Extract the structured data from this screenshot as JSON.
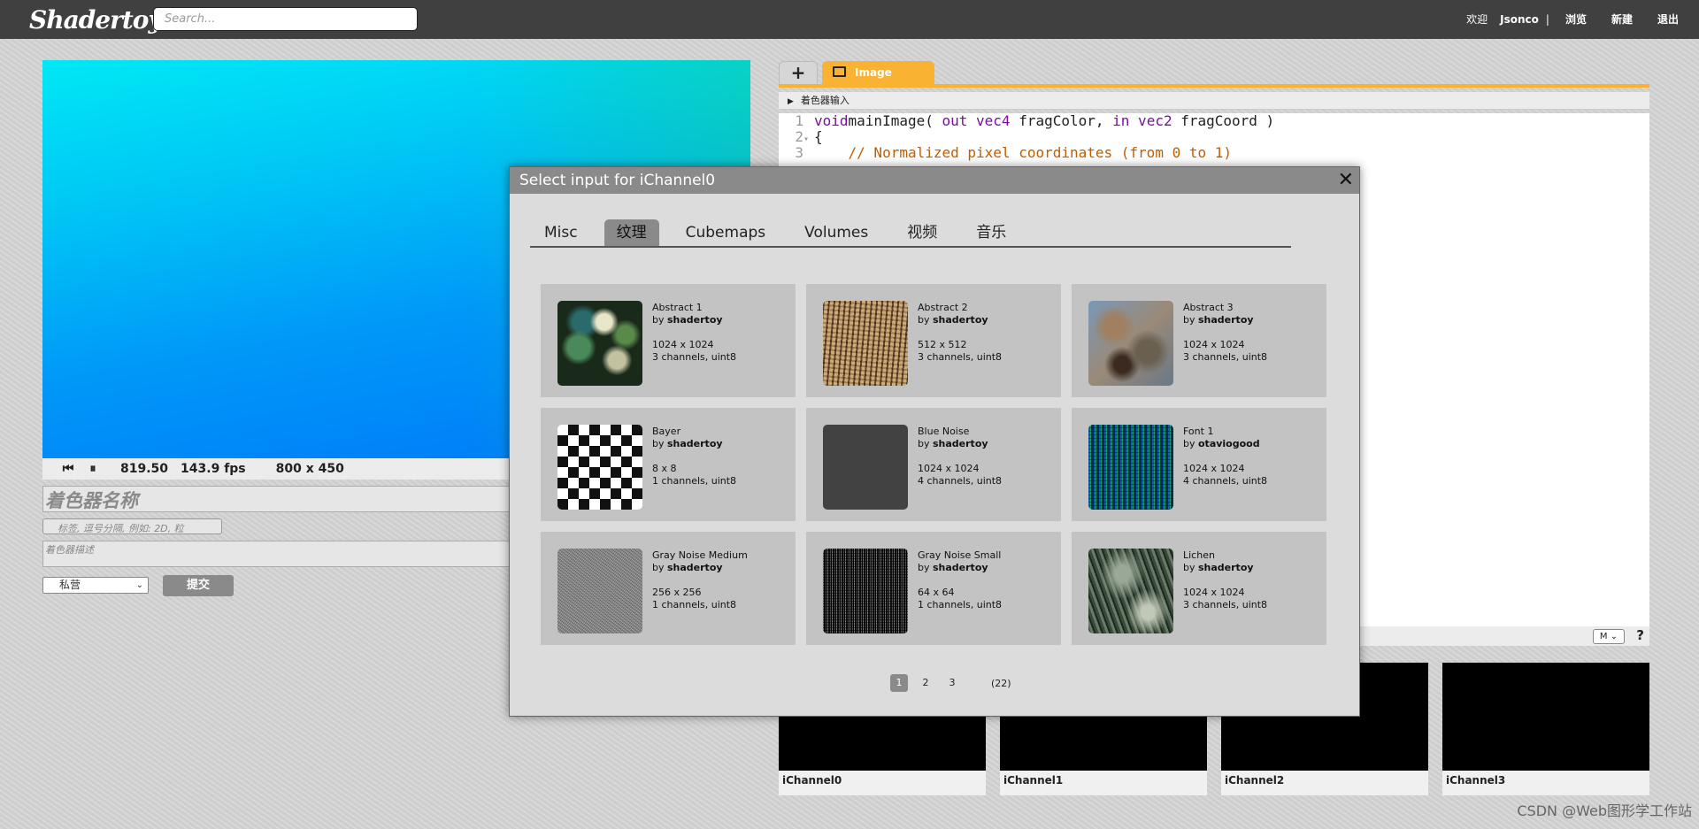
{
  "header": {
    "logo": "Shadertoy",
    "search_placeholder": "Search...",
    "nav": {
      "welcome": "欢迎",
      "user": "Jsonco",
      "separator": "|",
      "browse": "浏览",
      "new": "新建",
      "logout": "退出"
    }
  },
  "player": {
    "time": "819.50",
    "fps": "143.9 fps",
    "resolution": "800 x 450"
  },
  "form": {
    "name_placeholder": "着色器名称",
    "tags_placeholder": "标签, 逗号分隔, 例如: 2D, 粒",
    "description_placeholder": "着色器描述",
    "privacy": "私营",
    "submit": "提交"
  },
  "editor": {
    "tab_image": "Image",
    "inputs_bar": "着色器输入",
    "code": [
      {
        "num": "1",
        "fold": "",
        "parts": [
          [
            "kw",
            "void"
          ],
          [
            "",
            "mainImage( "
          ],
          [
            "kw",
            "out vec4"
          ],
          [
            "",
            " fragColor, "
          ],
          [
            "kw",
            "in vec2"
          ],
          [
            "",
            " fragCoord )"
          ]
        ]
      },
      {
        "num": "2",
        "fold": "▾",
        "parts": [
          [
            "",
            "{"
          ]
        ]
      },
      {
        "num": "3",
        "fold": "",
        "parts": [
          [
            "",
            "    "
          ],
          [
            "cm",
            "// Normalized pixel coordinates (from 0 to 1)"
          ]
        ]
      }
    ],
    "footer_select": "M",
    "help": "?"
  },
  "channels": [
    "iChannel0",
    "iChannel1",
    "iChannel2",
    "iChannel3"
  ],
  "modal": {
    "title": "Select input for iChannel0",
    "close": "✕",
    "tabs": [
      "Misc",
      "纹理",
      "Cubemaps",
      "Volumes",
      "视频",
      "音乐"
    ],
    "active_tab": 1,
    "textures": [
      {
        "name": "Abstract 1",
        "by": "by",
        "author": "shadertoy",
        "dims": "1024 x 1024",
        "format": "3 channels, uint8",
        "thumb": "t-abstract1"
      },
      {
        "name": "Abstract 2",
        "by": "by",
        "author": "shadertoy",
        "dims": "512 x 512",
        "format": "3 channels, uint8",
        "thumb": "t-abstract2b"
      },
      {
        "name": "Abstract 3",
        "by": "by",
        "author": "shadertoy",
        "dims": "1024 x 1024",
        "format": "3 channels, uint8",
        "thumb": "t-abstract3"
      },
      {
        "name": "Bayer",
        "by": "by",
        "author": "shadertoy",
        "dims": "8 x 8",
        "format": "1 channels, uint8",
        "thumb": "t-bayer"
      },
      {
        "name": "Blue Noise",
        "by": "by",
        "author": "shadertoy",
        "dims": "1024 x 1024",
        "format": "4 channels, uint8",
        "thumb": "t-bluenoise"
      },
      {
        "name": "Font 1",
        "by": "by",
        "author": "otaviogood",
        "dims": "1024 x 1024",
        "format": "4 channels, uint8",
        "thumb": "t-font2"
      },
      {
        "name": "Gray Noise Medium",
        "by": "by",
        "author": "shadertoy",
        "dims": "256 x 256",
        "format": "1 channels, uint8",
        "thumb": "t-graymed"
      },
      {
        "name": "Gray Noise Small",
        "by": "by",
        "author": "shadertoy",
        "dims": "64 x 64",
        "format": "1 channels, uint8",
        "thumb": "t-graysmall"
      },
      {
        "name": "Lichen",
        "by": "by",
        "author": "shadertoy",
        "dims": "1024 x 1024",
        "format": "3 channels, uint8",
        "thumb": "t-lichen"
      }
    ],
    "pages": [
      "1",
      "2",
      "3"
    ],
    "active_page": 0,
    "total": "(22)"
  },
  "watermark": "CSDN @Web图形学工作站"
}
